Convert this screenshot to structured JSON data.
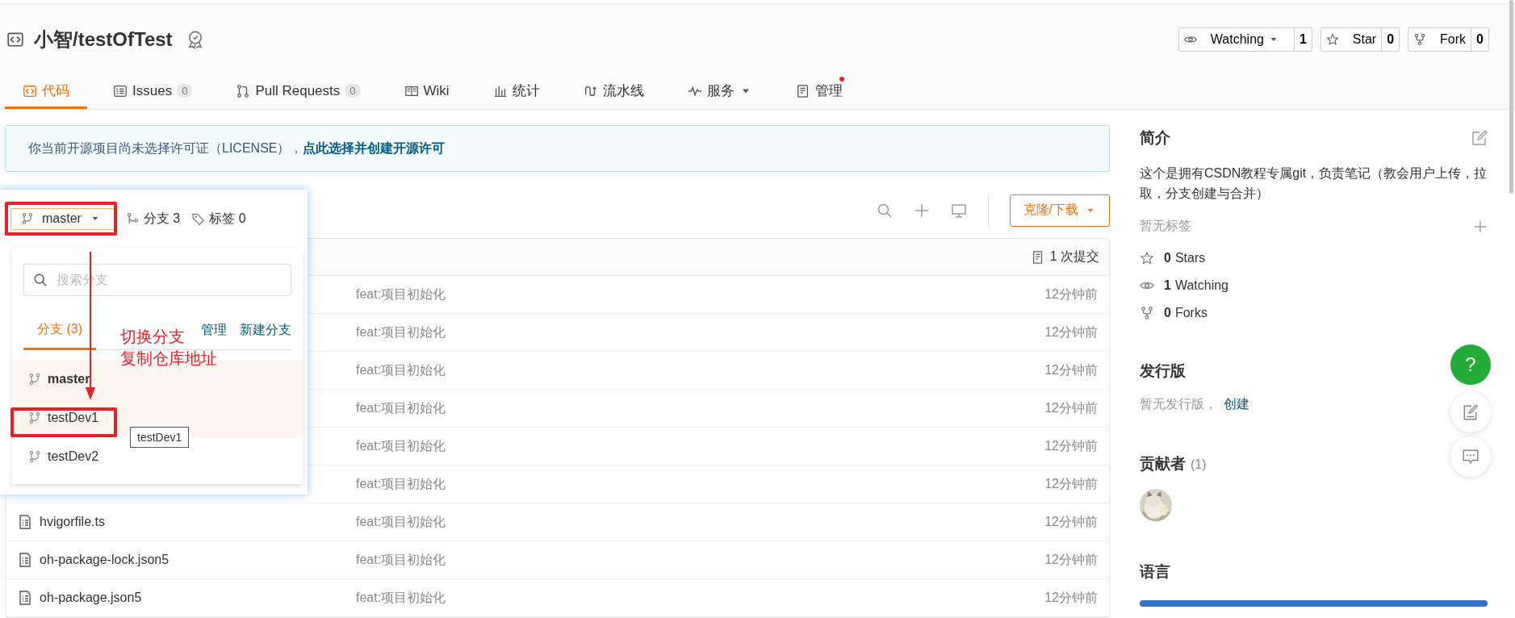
{
  "repo": {
    "title": "小智/testOfTest"
  },
  "actions": [
    {
      "kind": "watch",
      "label": "Watching",
      "count": "1",
      "dropdown": true
    },
    {
      "kind": "star",
      "label": "Star",
      "count": "0",
      "dropdown": false
    },
    {
      "kind": "fork",
      "label": "Fork",
      "count": "0",
      "dropdown": false
    }
  ],
  "tabs": [
    {
      "kind": "code",
      "label": "代码",
      "selected": true
    },
    {
      "kind": "issues",
      "label": "Issues",
      "count": "0",
      "selected": false
    },
    {
      "kind": "pulls",
      "label": "Pull Requests",
      "count": "0",
      "selected": false
    },
    {
      "kind": "wiki",
      "label": "Wiki",
      "selected": false
    },
    {
      "kind": "stats",
      "label": "统计",
      "selected": false
    },
    {
      "kind": "pipeline",
      "label": "流水线",
      "selected": false
    },
    {
      "kind": "service",
      "label": "服务",
      "selected": false,
      "dropdown": true
    },
    {
      "kind": "admin",
      "label": "管理",
      "selected": false,
      "dot": true
    }
  ],
  "notice": {
    "text": "你当前开源项目尚未选择许可证（LICENSE），",
    "link": "点此选择并创建开源许可"
  },
  "toolbar": {
    "branch": "master",
    "branches": "分支 3",
    "tags": "标签 0",
    "clone_button": "克隆/下载"
  },
  "files": {
    "commits": "1 次提交",
    "rows": [
      {
        "message": "feat:项目初始化",
        "time": "12分钟前"
      },
      {
        "message": "feat:项目初始化",
        "time": "12分钟前"
      },
      {
        "message": "feat:项目初始化",
        "time": "12分钟前"
      },
      {
        "message": "feat:项目初始化",
        "time": "12分钟前"
      },
      {
        "message": "feat:项目初始化",
        "time": "12分钟前"
      },
      {
        "message": "feat:项目初始化",
        "time": "12分钟前"
      },
      {
        "name": "hvigorfile.ts",
        "message": "feat:项目初始化",
        "time": "12分钟前"
      },
      {
        "name": "oh-package-lock.json5",
        "message": "feat:项目初始化",
        "time": "12分钟前"
      },
      {
        "name": "oh-package.json5",
        "message": "feat:项目初始化",
        "time": "12分钟前"
      }
    ]
  },
  "branch_dropdown": {
    "search": {
      "placeholder": "搜索分支"
    },
    "tabs": [
      {
        "label": "分支 (3)",
        "selected": true
      }
    ],
    "links": [
      "管理",
      "新建分支"
    ],
    "branches": [
      {
        "name": "master",
        "current": true,
        "highlighted": true
      },
      {
        "name": "testDev1",
        "current": false,
        "highlighted": true
      },
      {
        "name": "testDev2",
        "current": false,
        "highlighted": false
      }
    ],
    "tooltip": "testDev1"
  },
  "annotation": {
    "lines": [
      "切换分支",
      "复制仓库地址"
    ]
  },
  "sidebar": {
    "about": {
      "title": "简介",
      "description": "这个是拥有CSDN教程专属git，负责笔记（教会用户上传，拉取，分支创建与合并）",
      "tags_empty": "暂无标签",
      "stats": [
        {
          "kind": "star",
          "count": "0",
          "label": "Stars"
        },
        {
          "kind": "watch",
          "count": "1",
          "label": "Watching"
        },
        {
          "kind": "fork",
          "count": "0",
          "label": "Forks"
        }
      ]
    },
    "releases": {
      "title": "发行版",
      "empty": "暂无发行版，",
      "link": "创建"
    },
    "contributors": {
      "title": "贡献者",
      "count": "(1)"
    },
    "languages": {
      "title": "语言",
      "bars": [
        {
          "color": "#2f74c6"
        }
      ]
    }
  },
  "floating": {
    "help": "?"
  }
}
